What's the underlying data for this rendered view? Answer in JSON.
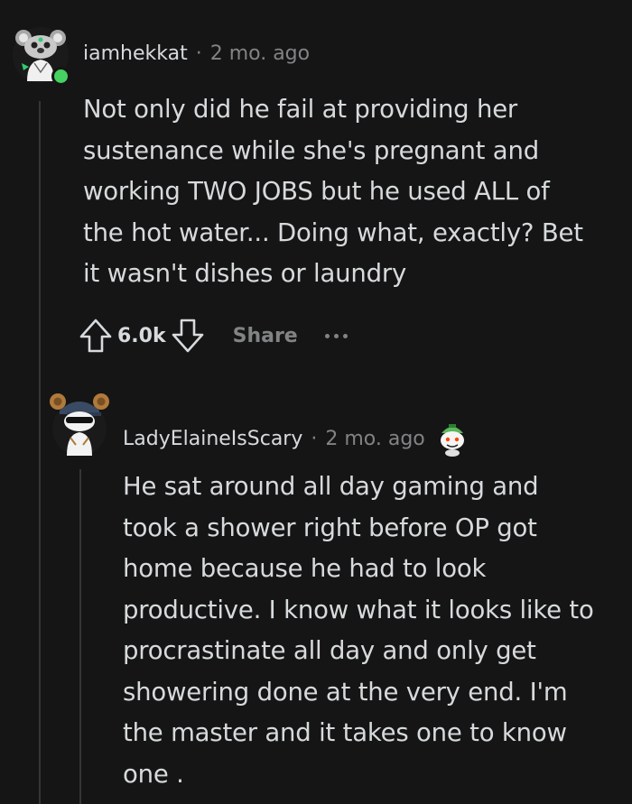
{
  "comments": [
    {
      "username": "iamhekkat",
      "separator": "·",
      "time": "2 mo. ago",
      "lines": [
        "Not only did he fail at providing her",
        "sustenance while she's pregnant and",
        "working TWO JOBS but he used ALL of",
        "the hot water... Doing what, exactly? Bet",
        "it wasn't dishes or laundry"
      ],
      "score": "6.0k",
      "share_label": "Share"
    },
    {
      "username": "LadyElaineIsScary",
      "separator": "·",
      "time": "2 mo. ago",
      "lines": [
        "He sat around all day gaming and",
        "took a shower right before OP got",
        "home because he had to look",
        "productive. I know what it looks like to",
        "procrastinate all day and only get",
        "showering done at the very end. I'm",
        "the master and it takes one to know",
        "one ."
      ]
    }
  ],
  "colors": {
    "background": "#151515",
    "text": "#d7dadc",
    "muted": "#818384",
    "online": "#46d160"
  }
}
